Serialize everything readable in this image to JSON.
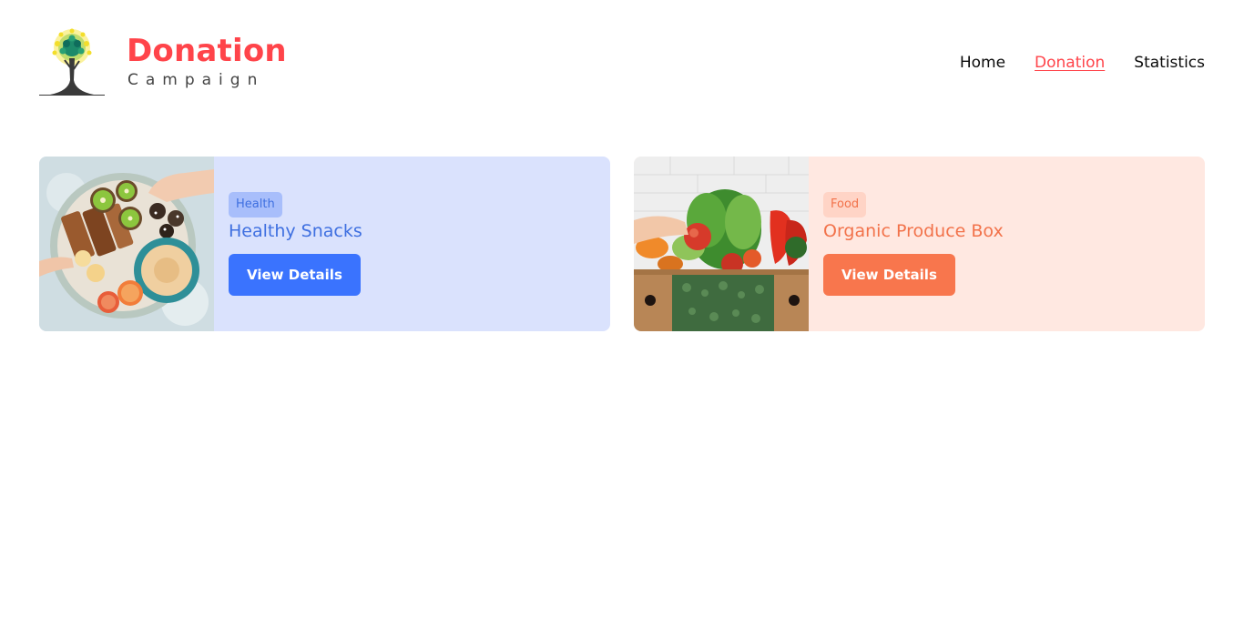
{
  "brand": {
    "title": "Donation",
    "subtitle": "Campaign",
    "logo_icon": "tree-logo-icon",
    "accent_color": "#FF444A"
  },
  "nav": {
    "items": [
      {
        "label": "Home",
        "active": false
      },
      {
        "label": "Donation",
        "active": true
      },
      {
        "label": "Statistics",
        "active": false
      }
    ]
  },
  "donations": [
    {
      "category": "Health",
      "title": "Healthy Snacks",
      "button_label": "View Details",
      "image": "healthy-snacks-photo",
      "colors": {
        "card_bg": "#DAE2FD",
        "category_bg": "#A8BEFB",
        "text": "#3E6FE0",
        "button": "#3A73FE"
      }
    },
    {
      "category": "Food",
      "title": "Organic Produce Box",
      "button_label": "View Details",
      "image": "organic-produce-box-photo",
      "colors": {
        "card_bg": "#FFE8E1",
        "category_bg": "#FFD4C6",
        "text": "#F2724A",
        "button": "#F8764D"
      }
    }
  ]
}
